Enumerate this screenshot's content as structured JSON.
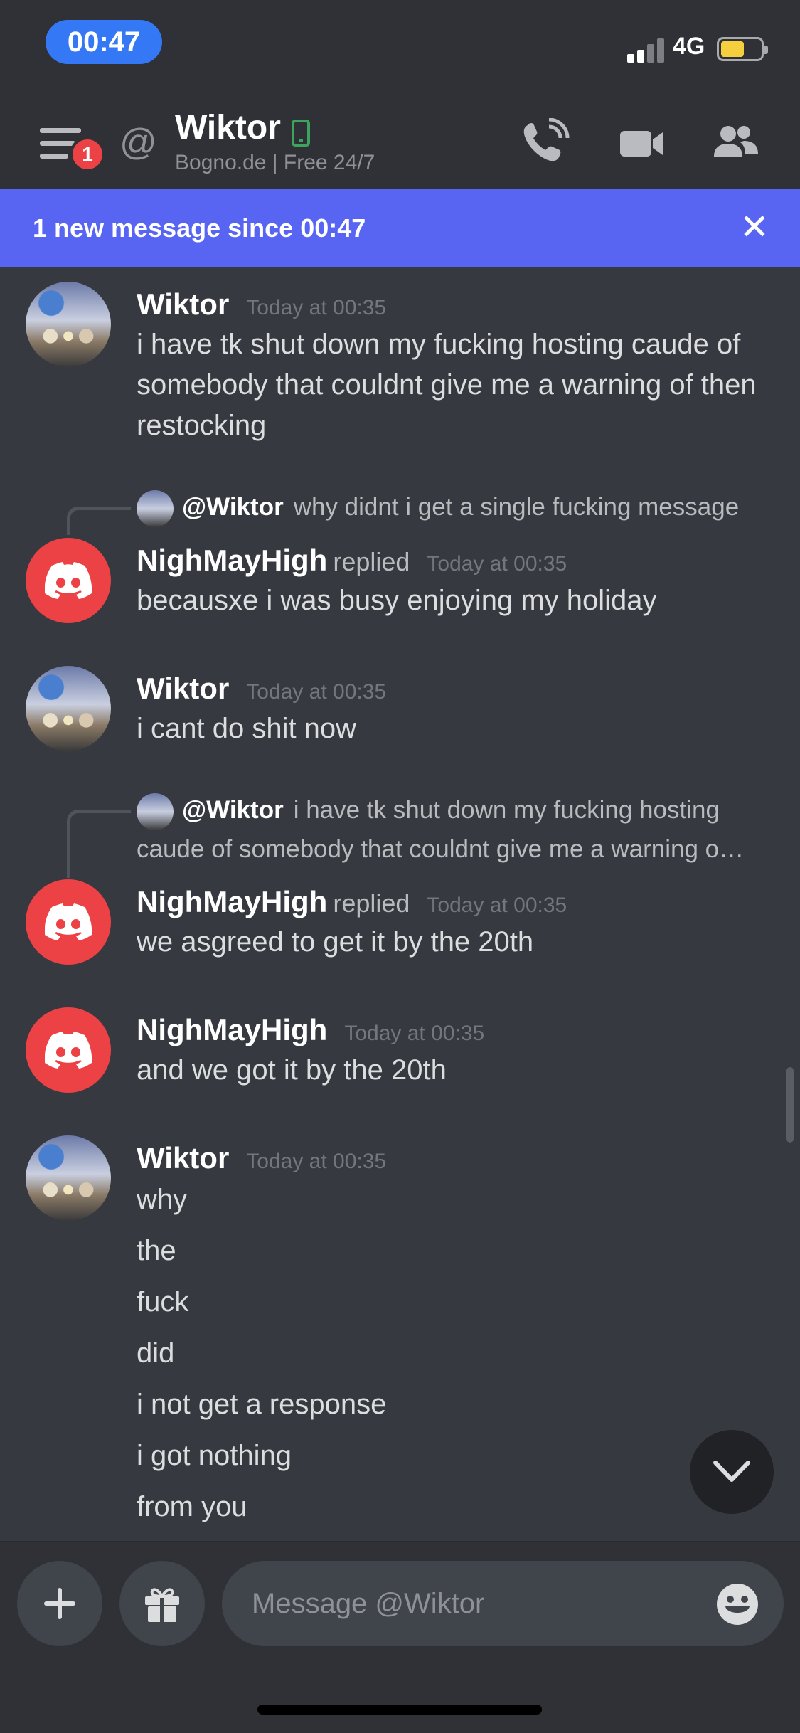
{
  "status_bar": {
    "time": "00:47",
    "network": "4G"
  },
  "header": {
    "mention_count": "1",
    "title": "Wiktor",
    "status": "Bogno.de  | Free 24/7",
    "icons": [
      "menu-icon",
      "at-icon",
      "mobile-icon",
      "call-icon",
      "video-icon",
      "members-icon"
    ]
  },
  "banner": {
    "text": "1 new message since 00:47",
    "close_glyph": "✕"
  },
  "messages": [
    {
      "author": "Wiktor",
      "timestamp": "Today at 00:35",
      "text": "i have tk shut down my fucking hosting caude of somebody that couldnt give me a warning of then restocking"
    },
    {
      "reply_to": {
        "author": "@Wiktor",
        "text": "why didnt i get a single fucking message"
      },
      "author": "NighMayHigh",
      "replied_label": "replied",
      "timestamp": "Today at 00:35",
      "text": "becausxe i was busy enjoying my holiday"
    },
    {
      "author": "Wiktor",
      "timestamp": "Today at 00:35",
      "text": "i cant do shit now"
    },
    {
      "reply_to": {
        "author": "@Wiktor",
        "text": "i have tk shut down my fucking hosting caude of somebody that couldnt give me a warning o…"
      },
      "author": "NighMayHigh",
      "replied_label": "replied",
      "timestamp": "Today at 00:35",
      "text": "we asgreed to get it by the 20th"
    },
    {
      "author": "NighMayHigh",
      "timestamp": "Today at 00:35",
      "text": "and we got it by the 20th"
    },
    {
      "author": "Wiktor",
      "timestamp": "Today at 00:35",
      "lines": [
        "why",
        "the",
        "fuck",
        "did",
        "i not get a response",
        "i got nothing",
        "from you"
      ]
    }
  ],
  "composer": {
    "placeholder": "Message @Wiktor",
    "icons": [
      "plus-icon",
      "gift-icon",
      "emoji-icon"
    ]
  },
  "colors": {
    "background": "#36393f",
    "header": "#2f3136",
    "banner": "#5865f2",
    "discord_avatar": "#ed4245",
    "online_mobile": "#3ba55d",
    "time_pill": "#3478f6"
  }
}
